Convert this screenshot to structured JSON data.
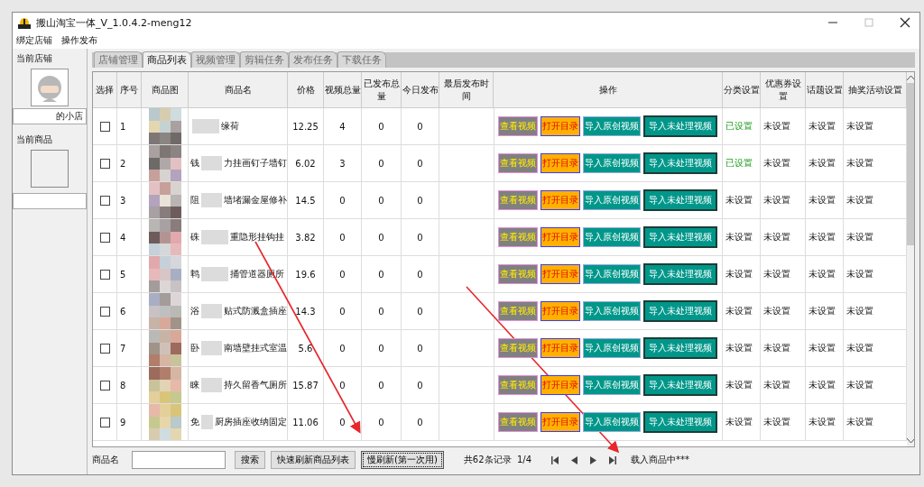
{
  "window": {
    "title": "搬山淘宝一体_V_1.0.4.2-meng12"
  },
  "menu": [
    "绑定店铺",
    "操作发布"
  ],
  "left_panel": {
    "shop_group": "当前店铺",
    "shop_name": "的小店",
    "product_group": "当前商品"
  },
  "tabs": [
    {
      "label": "店铺管理",
      "selected": false
    },
    {
      "label": "商品列表",
      "selected": true
    },
    {
      "label": "视频管理",
      "selected": false
    },
    {
      "label": "剪辑任务",
      "selected": false
    },
    {
      "label": "发布任务",
      "selected": false
    },
    {
      "label": "下载任务",
      "selected": false
    }
  ],
  "table": {
    "columns": [
      "选择",
      "序号",
      "商品图",
      "商品名",
      "价格",
      "视频总量",
      "已发布总量",
      "今日发布",
      "最后发布时间",
      "操作",
      "分类设置",
      "优惠券设置",
      "话题设置",
      "抽奖活动设置"
    ],
    "rows": [
      {
        "checked": false,
        "index": "1",
        "name_end": "缘荷",
        "price": "12.25",
        "videos": "4",
        "published": "0",
        "today": "0",
        "actions": [
          {
            "kind": "view",
            "label": "查看视频"
          },
          {
            "kind": "open",
            "label": "打开目录"
          },
          {
            "kind": "import",
            "label": "导入原创视频"
          },
          {
            "kind": "raw",
            "label": "导入未处理视频"
          }
        ],
        "settings": [
          {
            "text": "已设置",
            "set": true
          },
          {
            "text": "未设置",
            "set": false
          },
          {
            "text": "未设置",
            "set": false
          },
          {
            "text": "未设置",
            "set": false
          }
        ]
      },
      {
        "checked": false,
        "index": "2",
        "name_start": "钱",
        "name_end": "力挂画钉子墙钉",
        "price": "6.02",
        "videos": "3",
        "published": "0",
        "today": "0",
        "actions": [
          {
            "kind": "view",
            "label": "查看视频"
          },
          {
            "kind": "open",
            "label": "打开目录"
          },
          {
            "kind": "import",
            "label": "导入原创视频"
          },
          {
            "kind": "raw",
            "label": "导入未处理视频"
          }
        ],
        "settings": [
          {
            "text": "已设置",
            "set": true
          },
          {
            "text": "未设置",
            "set": false
          },
          {
            "text": "未设置",
            "set": false
          },
          {
            "text": "未设置",
            "set": false
          }
        ]
      },
      {
        "checked": false,
        "index": "3",
        "name_start": "阻",
        "name_end": "墙堵漏金屋修补",
        "price": "14.5",
        "videos": "0",
        "published": "0",
        "today": "0",
        "actions": [
          {
            "kind": "view",
            "label": "查看视频"
          },
          {
            "kind": "open",
            "label": "打开目录"
          },
          {
            "kind": "import",
            "label": "导入原创视频"
          },
          {
            "kind": "raw",
            "label": "导入未处理视频"
          }
        ],
        "settings": [
          {
            "text": "未设置",
            "set": false
          },
          {
            "text": "未设置",
            "set": false
          },
          {
            "text": "未设置",
            "set": false
          },
          {
            "text": "未设置",
            "set": false
          }
        ]
      },
      {
        "checked": false,
        "index": "4",
        "name_start": "硃",
        "name_end": "重隐形挂钩挂",
        "price": "3.82",
        "videos": "0",
        "published": "0",
        "today": "0",
        "actions": [
          {
            "kind": "view",
            "label": "查看视频"
          },
          {
            "kind": "open",
            "label": "打开目录"
          },
          {
            "kind": "import",
            "label": "导入原创视频"
          },
          {
            "kind": "raw",
            "label": "导入未处理视频"
          }
        ],
        "settings": [
          {
            "text": "未设置",
            "set": false
          },
          {
            "text": "未设置",
            "set": false
          },
          {
            "text": "未设置",
            "set": false
          },
          {
            "text": "未设置",
            "set": false
          }
        ]
      },
      {
        "checked": false,
        "index": "5",
        "name_start": "鹎",
        "name_end": "捅管道器厕所",
        "price": "19.6",
        "videos": "0",
        "published": "0",
        "today": "0",
        "actions": [
          {
            "kind": "view",
            "label": "查看视频"
          },
          {
            "kind": "open",
            "label": "打开目录"
          },
          {
            "kind": "import",
            "label": "导入原创视频"
          },
          {
            "kind": "raw",
            "label": "导入未处理视频"
          }
        ],
        "settings": [
          {
            "text": "未设置",
            "set": false
          },
          {
            "text": "未设置",
            "set": false
          },
          {
            "text": "未设置",
            "set": false
          },
          {
            "text": "未设置",
            "set": false
          }
        ]
      },
      {
        "checked": false,
        "index": "6",
        "name_start": "浴",
        "name_end": "贴式防溅盒插座",
        "price": "14.3",
        "videos": "0",
        "published": "0",
        "today": "0",
        "actions": [
          {
            "kind": "view",
            "label": "查看视频"
          },
          {
            "kind": "open",
            "label": "打开目录"
          },
          {
            "kind": "import",
            "label": "导入原创视频"
          },
          {
            "kind": "raw",
            "label": "导入未处理视频"
          }
        ],
        "settings": [
          {
            "text": "未设置",
            "set": false
          },
          {
            "text": "未设置",
            "set": false
          },
          {
            "text": "未设置",
            "set": false
          },
          {
            "text": "未设置",
            "set": false
          }
        ]
      },
      {
        "checked": false,
        "index": "7",
        "name_start": "卧",
        "name_end": "南墙壁挂式室温",
        "price": "5.6",
        "videos": "0",
        "published": "0",
        "today": "0",
        "actions": [
          {
            "kind": "view",
            "label": "查看视频"
          },
          {
            "kind": "open",
            "label": "打开目录"
          },
          {
            "kind": "import",
            "label": "导入原创视频"
          },
          {
            "kind": "raw",
            "label": "导入未处理视频"
          }
        ],
        "settings": [
          {
            "text": "未设置",
            "set": false
          },
          {
            "text": "未设置",
            "set": false
          },
          {
            "text": "未设置",
            "set": false
          },
          {
            "text": "未设置",
            "set": false
          }
        ]
      },
      {
        "checked": false,
        "index": "8",
        "name_start": "睐",
        "name_end": "持久留香气厕所",
        "price": "15.87",
        "videos": "0",
        "published": "0",
        "today": "0",
        "actions": [
          {
            "kind": "view",
            "label": "查看视频"
          },
          {
            "kind": "open",
            "label": "打开目录"
          },
          {
            "kind": "import",
            "label": "导入原创视频"
          },
          {
            "kind": "raw",
            "label": "导入未处理视频"
          }
        ],
        "settings": [
          {
            "text": "未设置",
            "set": false
          },
          {
            "text": "未设置",
            "set": false
          },
          {
            "text": "未设置",
            "set": false
          },
          {
            "text": "未设置",
            "set": false
          }
        ]
      },
      {
        "checked": false,
        "index": "9",
        "name_start": "免",
        "name_end": "厨房插座收纳固定",
        "price": "11.06",
        "videos": "0",
        "published": "0",
        "today": "0",
        "actions": [
          {
            "kind": "view",
            "label": "查看视频"
          },
          {
            "kind": "open",
            "label": "打开目录"
          },
          {
            "kind": "import",
            "label": "导入原创视频"
          },
          {
            "kind": "raw",
            "label": "导入未处理视频"
          }
        ],
        "settings": [
          {
            "text": "未设置",
            "set": false
          },
          {
            "text": "未设置",
            "set": false
          },
          {
            "text": "未设置",
            "set": false
          },
          {
            "text": "未设置",
            "set": false
          }
        ]
      }
    ]
  },
  "bottom_bar": {
    "search_label": "商品名",
    "buttons": [
      {
        "label": "搜索",
        "focused": false
      },
      {
        "label": "快速刷新商品列表",
        "focused": false
      },
      {
        "label": "慢刷新(第一次用)",
        "focused": true
      }
    ],
    "records": "共62条记录  1/4",
    "status": "载入商品中***"
  }
}
